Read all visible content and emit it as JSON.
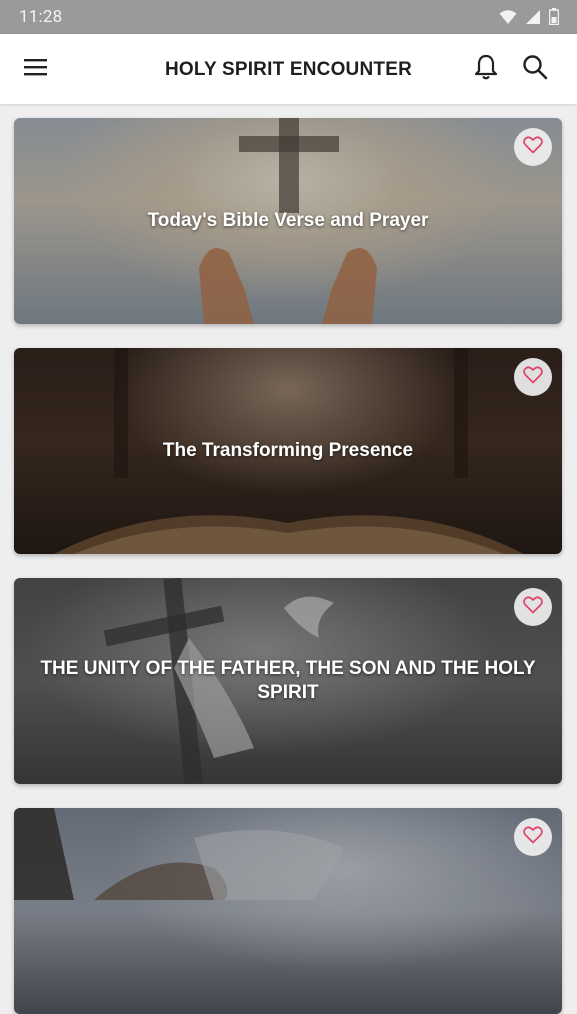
{
  "status_bar": {
    "time": "11:28",
    "icons": [
      "wifi-icon",
      "signal-icon",
      "battery-icon"
    ]
  },
  "app_bar": {
    "title": "HOLY SPIRIT ENCOUNTER",
    "icons": [
      "menu-icon",
      "bell-icon",
      "search-icon"
    ]
  },
  "cards": [
    {
      "title": "Today's Bible Verse and Prayer",
      "favorite_icon": "heart-outline-icon"
    },
    {
      "title": "The Transforming Presence",
      "favorite_icon": "heart-outline-icon"
    },
    {
      "title": "THE UNITY OF THE FATHER, THE SON AND THE HOLY SPIRIT",
      "favorite_icon": "heart-outline-icon"
    },
    {
      "title": "",
      "favorite_icon": "heart-outline-icon"
    }
  ],
  "colors": {
    "status_bar": "#9a9a9a",
    "app_bar": "#ffffff",
    "background": "#eeeeee",
    "heart_accent": "#e0426a"
  }
}
